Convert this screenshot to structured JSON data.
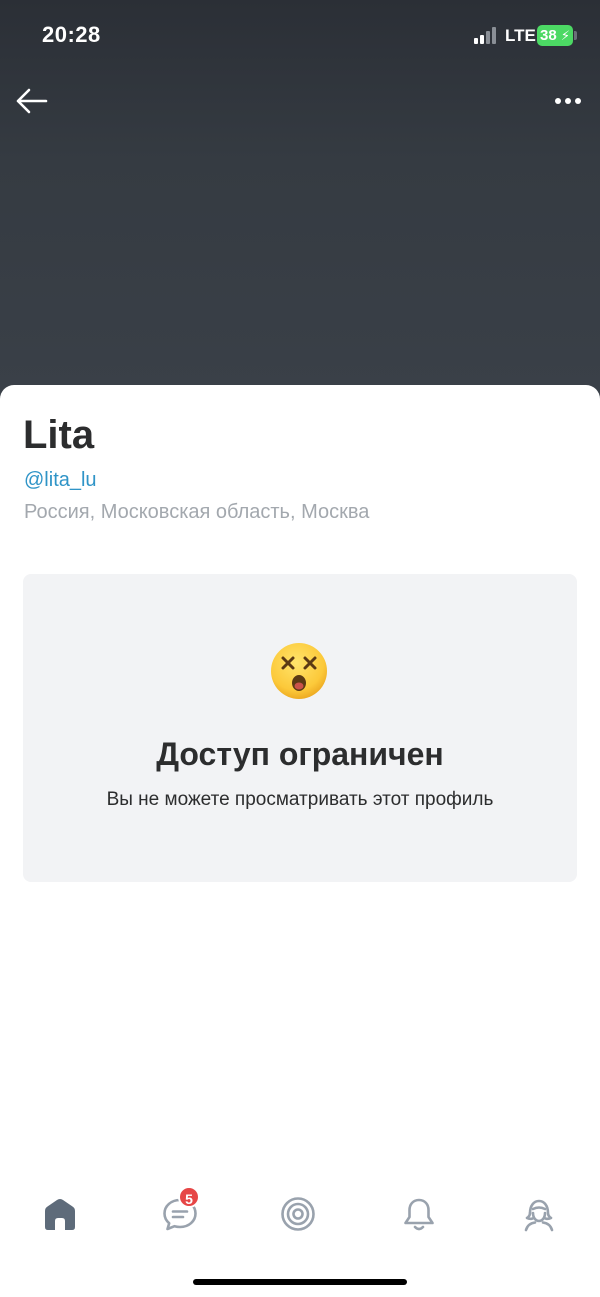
{
  "status_bar": {
    "time": "20:28",
    "network": "LTE",
    "battery_level": "38",
    "battery_charging": true
  },
  "header": {
    "back_icon": "arrow-left-icon",
    "more_icon": "more-horizontal-icon"
  },
  "profile": {
    "name": "Lita",
    "handle": "@lita_lu",
    "location": "Россия, Московская область, Москва"
  },
  "restricted": {
    "icon": "dizzy-face-emoji",
    "title": "Доступ ограничен",
    "message": "Вы не можете просматривать этот профиль"
  },
  "tabbar": {
    "items": [
      {
        "icon": "home-icon",
        "active": true
      },
      {
        "icon": "messages-icon",
        "badge": "5"
      },
      {
        "icon": "target-icon"
      },
      {
        "icon": "bell-icon"
      },
      {
        "icon": "profile-icon"
      }
    ]
  },
  "colors": {
    "header_bg": "#353b42",
    "link": "#2f94c7",
    "card_bg": "#f2f3f5",
    "badge": "#e64646",
    "icon_gray": "#99a2ad",
    "icon_active": "#5e6b7a"
  }
}
